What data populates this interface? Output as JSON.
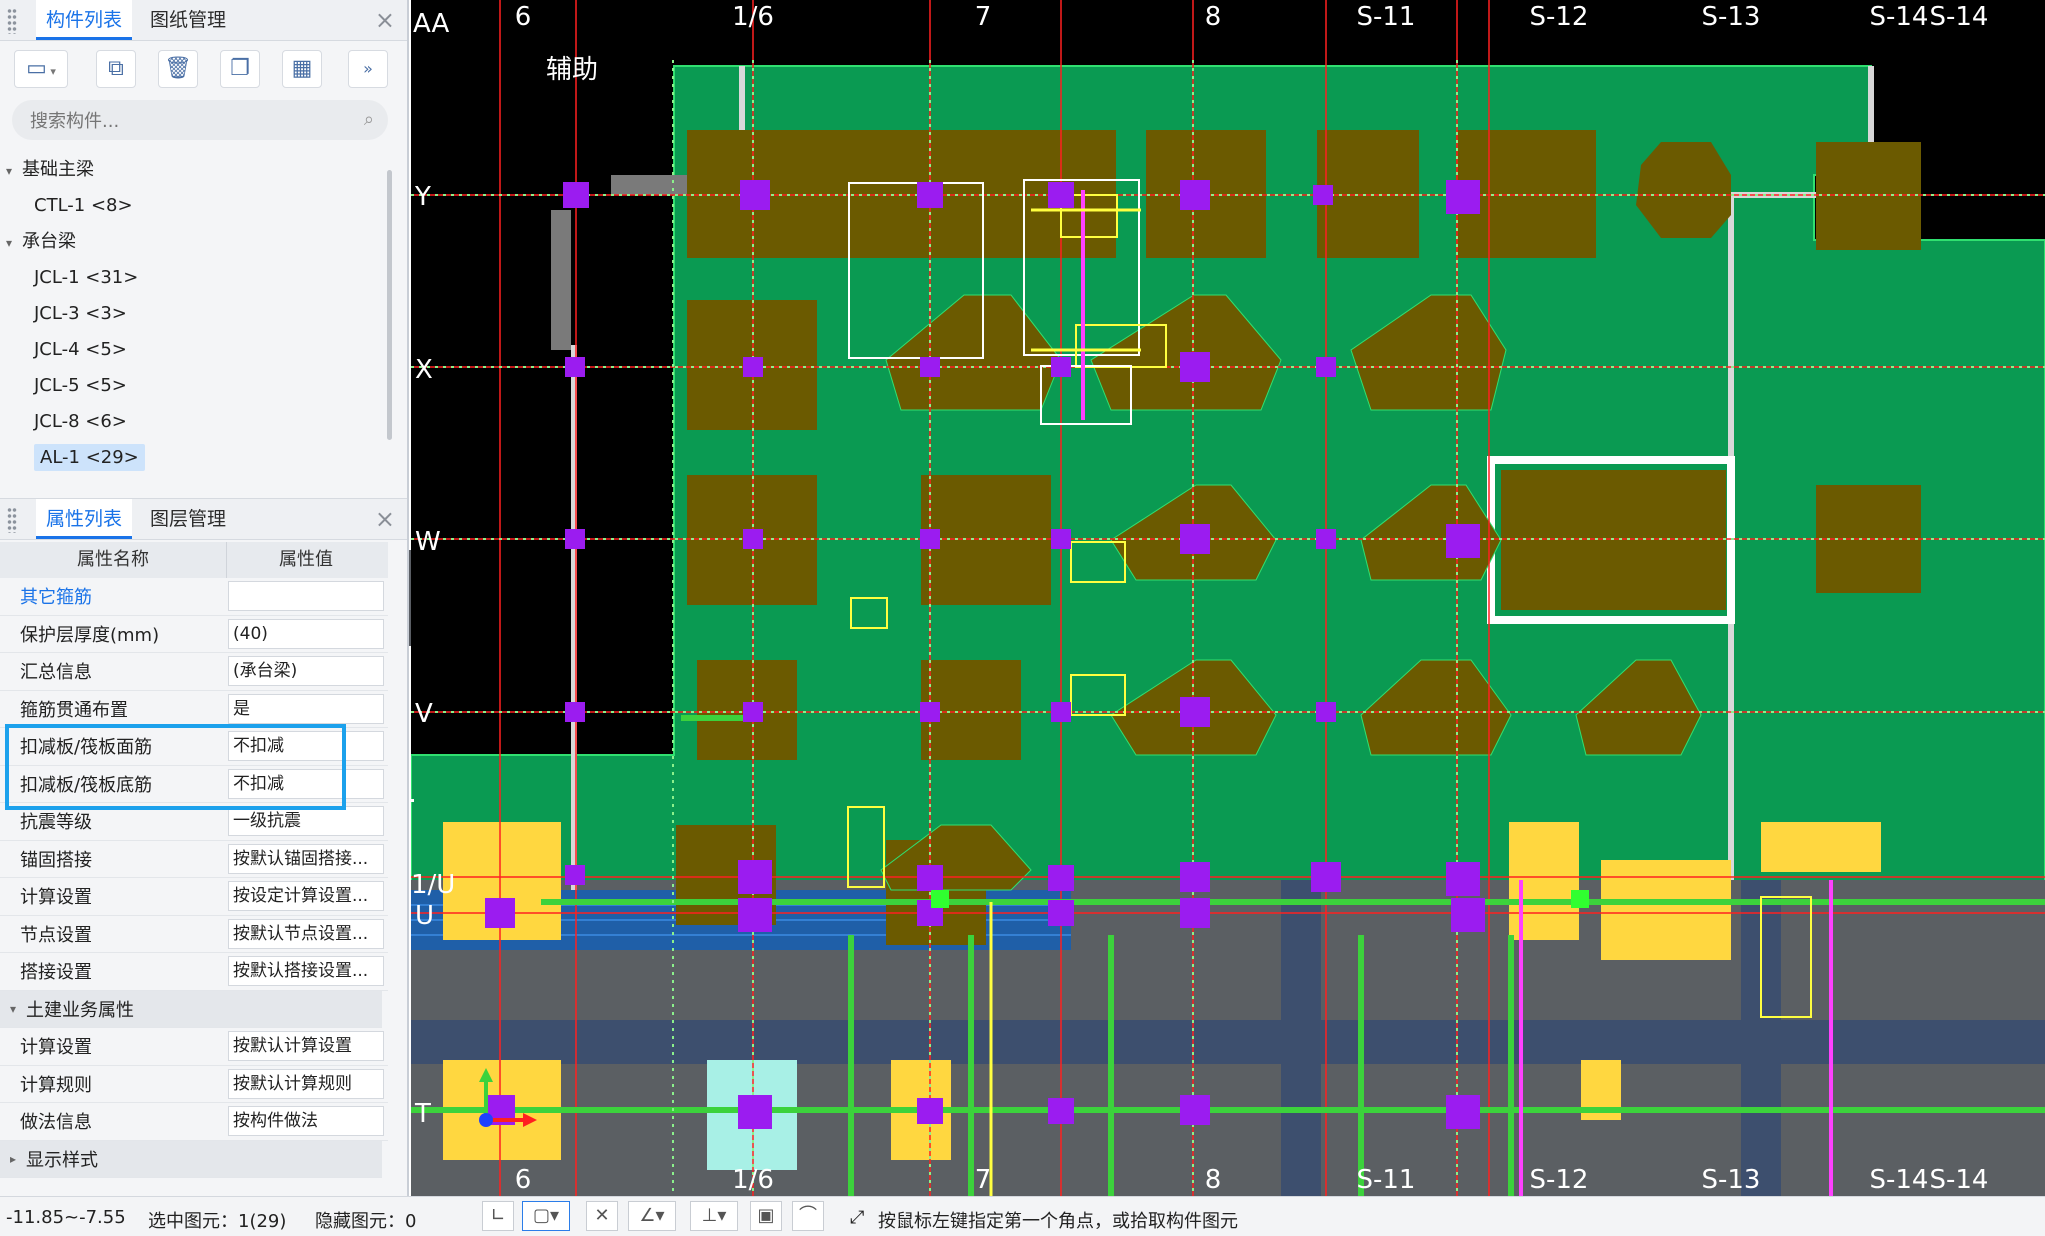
{
  "component_panel": {
    "tabs": [
      "构件列表",
      "图纸管理"
    ],
    "search_placeholder": "搜索构件...",
    "tree": [
      {
        "label": "基础主梁",
        "children": [
          "CTL-1 <8>"
        ]
      },
      {
        "label": "承台梁",
        "children": [
          "JCL-1 <31>",
          "JCL-3 <3>",
          "JCL-4 <5>",
          "JCL-5 <5>",
          "JCL-8 <6>",
          "AL-1 <29>"
        ]
      }
    ],
    "selected_item": "AL-1 <29>"
  },
  "property_panel": {
    "tabs": [
      "属性列表",
      "图层管理"
    ],
    "headers": [
      "属性名称",
      "属性值"
    ],
    "rows": [
      {
        "name": "其它箍筋",
        "value": "",
        "link": true
      },
      {
        "name": "保护层厚度(mm)",
        "value": "(40)"
      },
      {
        "name": "汇总信息",
        "value": "(承台梁)"
      },
      {
        "name": "箍筋贯通布置",
        "value": "是"
      },
      {
        "name": "扣减板/筏板面筋",
        "value": "不扣减"
      },
      {
        "name": "扣减板/筏板底筋",
        "value": "不扣减"
      },
      {
        "name": "抗震等级",
        "value": "一级抗震"
      },
      {
        "name": "锚固搭接",
        "value": "按默认锚固搭接..."
      },
      {
        "name": "计算设置",
        "value": "按设定计算设置..."
      },
      {
        "name": "节点设置",
        "value": "按默认节点设置..."
      },
      {
        "name": "搭接设置",
        "value": "按默认搭接设置..."
      }
    ],
    "group_civil": "土建业务属性",
    "civil_rows": [
      {
        "name": "计算设置",
        "value": "按默认计算设置"
      },
      {
        "name": "计算规则",
        "value": "按默认计算规则"
      },
      {
        "name": "做法信息",
        "value": "按构件做法"
      }
    ],
    "group_display": "显示样式"
  },
  "canvas": {
    "aux_label": "辅助",
    "x_axes": [
      "6",
      "1/6",
      "7",
      "8",
      "S-11",
      "S-12",
      "S-13",
      "S-14",
      "S-14"
    ],
    "bottom_axes": [
      "6",
      "1/6",
      "7",
      "8",
      "S-11",
      "S-12",
      "S-13",
      "S-14",
      "S-14"
    ],
    "y_axes": [
      "AA",
      "Y",
      "X",
      "W",
      "V",
      "1/U",
      "U",
      "T"
    ],
    "colors": {
      "slab": "#0a9a52",
      "pile_cap": "#6b5a00",
      "column": "#9b1cf0",
      "grid": "#ff2020",
      "rebar": "#3cd23c",
      "yellow_cap": "#ffd740"
    }
  },
  "status_bar": {
    "coords": "-11.85~-7.55",
    "selected": "选中图元：1(29)",
    "hidden": "隐藏图元：0",
    "hint": "按鼠标左键指定第一个角点，或拾取构件图元"
  }
}
